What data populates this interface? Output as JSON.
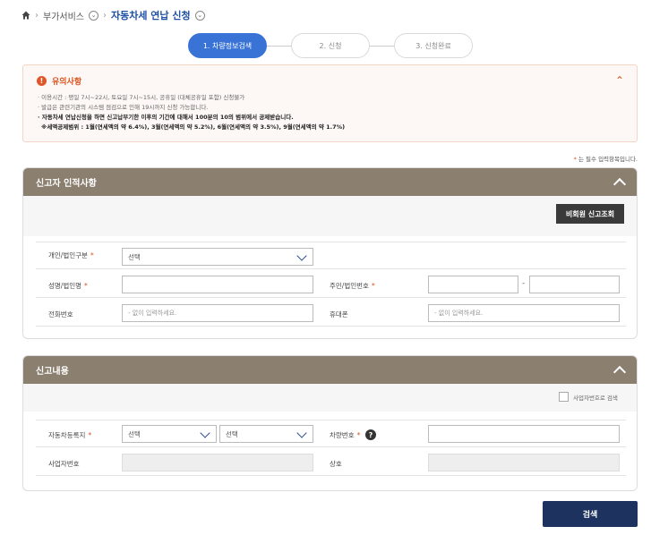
{
  "breadcrumb": {
    "level1": "부가서비스",
    "current": "자동차세 연납 신청"
  },
  "steps": [
    {
      "label": "1. 차량정보검색",
      "active": true
    },
    {
      "label": "2. 신청",
      "active": false
    },
    {
      "label": "3. 신청완료",
      "active": false
    }
  ],
  "notice": {
    "title": "유의사항",
    "lines": [
      "· 이용시간 : 평일 7시~22시, 토요일 7시~15시, 공휴일 (대체공휴일 포함) 신청불가",
      "· 발급은 관련기관의 시스템 점검으로 인해 19시까지 신청 가능합니다.",
      "· 자동차세 연납신청을 하면 신고납부기한 이후의 기간에 대해서 100분의 10의 범위에서 공제받습니다.",
      "※세액공제범위 : 1월(연세액의 약 6.4%), 3월(연세액의 약 5.2%), 6월(연세액의 약 3.5%), 9월(연세액의 약 1.7%)"
    ]
  },
  "required_note": {
    "star": "*",
    "text": "는 필수 입력항목입니다."
  },
  "section1": {
    "title": "신고자 인적사항",
    "nonmember_button": "비회원 신고조회",
    "person_type_label": "개인/법인구분",
    "person_type_value": "선택",
    "name_label": "성명/법인명",
    "id_label": "주민/법인번호",
    "phone_label": "전화번호",
    "phone_placeholder": "- 없이 입력하세요.",
    "mobile_label": "휴대폰",
    "mobile_placeholder": "- 없이 입력하세요."
  },
  "section2": {
    "title": "신고내용",
    "biz_check_label": "사업자번호로 검색",
    "region_label": "자동차등록지",
    "region_sel1": "선택",
    "region_sel2": "선택",
    "plate_label": "차량번호",
    "biz_no_label": "사업자번호",
    "company_label": "상호"
  },
  "search_button": "검색",
  "colors": {
    "accent": "#3a73d6",
    "panel_header": "#8b7f6f",
    "search_button": "#1e3260",
    "required": "#d9531e"
  }
}
